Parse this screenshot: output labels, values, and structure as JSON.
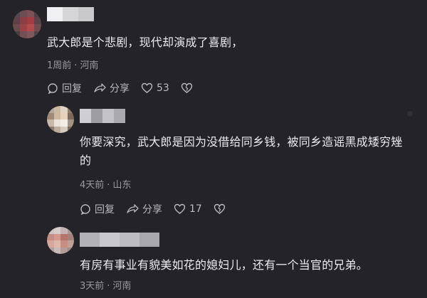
{
  "comments": [
    {
      "text": "武大郎是个悲剧，现代却演成了喜剧，",
      "time": "1周前",
      "location": "河南",
      "reply_label": "回复",
      "share_label": "分享",
      "like_count": "53"
    },
    {
      "text": "你要深究，武大郎是因为没借给同乡钱，被同乡造谣黑成矮穷矬的",
      "time": "4天前",
      "location": "山东",
      "reply_label": "回复",
      "share_label": "分享",
      "like_count": "17"
    },
    {
      "text": "有房有事业有貌美如花的媳妇儿，还有一个当官的兄弟。",
      "time": "3天前",
      "location": "河南"
    }
  ],
  "meta_separator": "·",
  "icons": {
    "reply": "reply-icon",
    "share": "share-icon",
    "like": "heart-icon",
    "dislike": "broken-heart-icon"
  },
  "colors": {
    "background": "#242428",
    "text": "#ecebef",
    "meta": "#9a9aa0",
    "action": "#b9b9be"
  }
}
